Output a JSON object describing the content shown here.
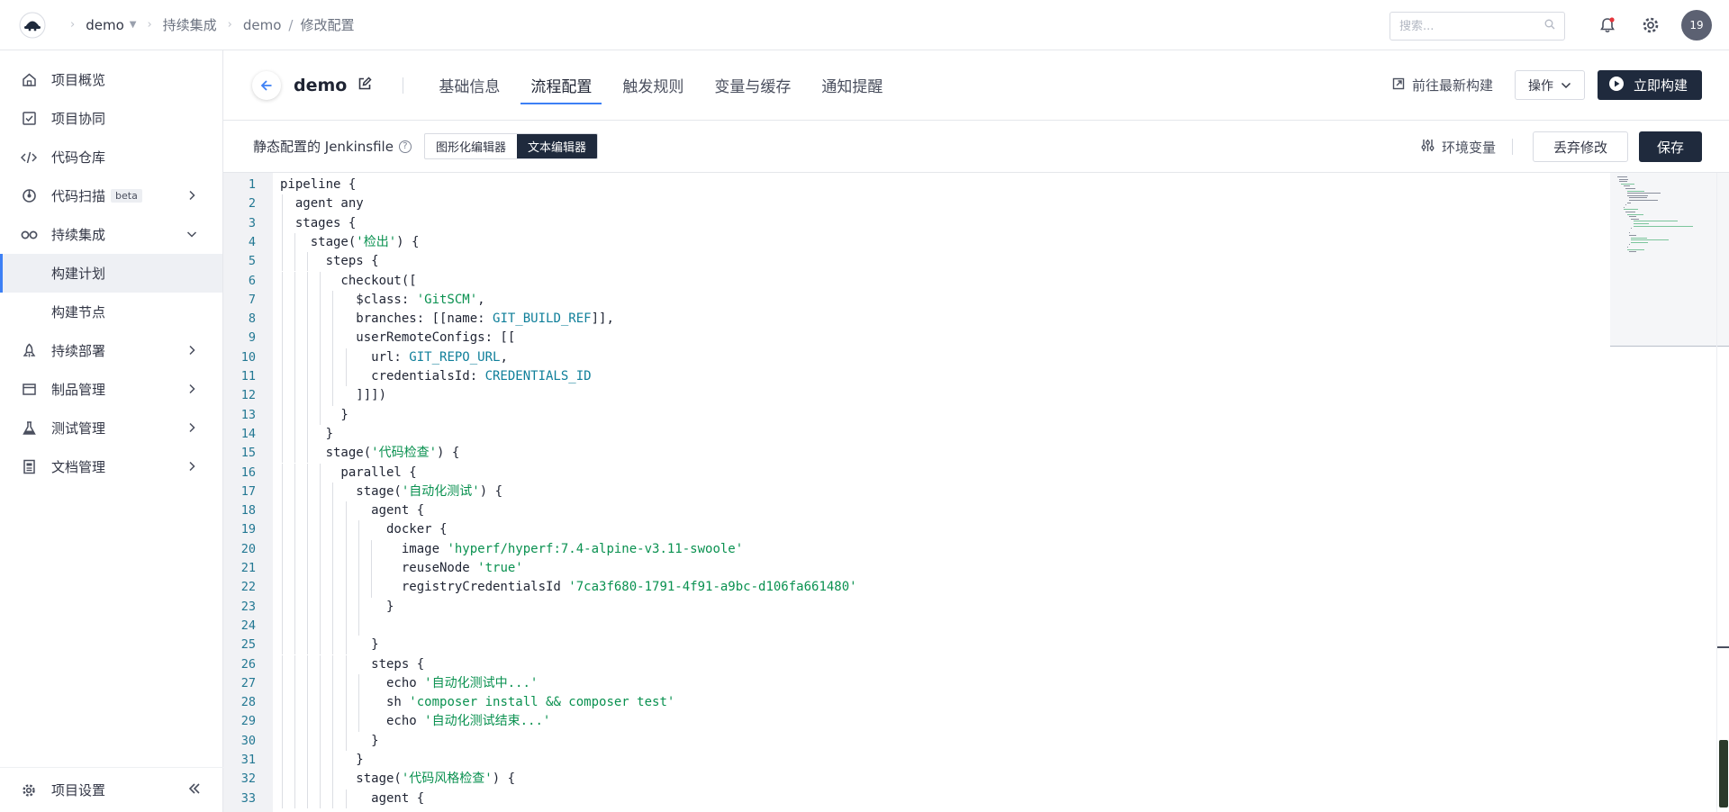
{
  "topbar": {
    "project": "demo",
    "breadcrumb": [
      "持续集成",
      "demo",
      "修改配置"
    ],
    "search_placeholder": "搜索...",
    "avatar": "19"
  },
  "sidebar": {
    "items": [
      {
        "label": "项目概览",
        "icon": "home-icon"
      },
      {
        "label": "项目协同",
        "icon": "checkbox-icon"
      },
      {
        "label": "代码仓库",
        "icon": "code-icon"
      },
      {
        "label": "代码扫描",
        "icon": "scan-icon",
        "badge": "beta"
      },
      {
        "label": "持续集成",
        "icon": "infinity-icon"
      },
      {
        "label": "构建计划",
        "icon": ""
      },
      {
        "label": "构建节点",
        "icon": ""
      },
      {
        "label": "持续部署",
        "icon": "rocket-icon"
      },
      {
        "label": "制品管理",
        "icon": "box-icon"
      },
      {
        "label": "测试管理",
        "icon": "flask-icon"
      },
      {
        "label": "文档管理",
        "icon": "doc-icon"
      }
    ],
    "settings": "项目设置"
  },
  "header": {
    "title": "demo",
    "tabs": [
      "基础信息",
      "流程配置",
      "触发规则",
      "变量与缓存",
      "通知提醒"
    ],
    "active_tab": "流程配置",
    "latest_build": "前往最新构建",
    "ops": "操作",
    "build_now": "立即构建"
  },
  "toolbar": {
    "label": "静态配置的 Jenkinsfile",
    "help": "?",
    "mode_graphic": "图形化编辑器",
    "mode_text": "文本编辑器",
    "env": "环境变量",
    "discard": "丢弃修改",
    "save": "保存"
  },
  "colors": {
    "accent": "#3d80f5",
    "dark_button": "#1f2a3d",
    "string": "#0a9150",
    "variable": "#0f7f9a",
    "line_number": "#237893"
  },
  "editor": {
    "lines": [
      "pipeline {",
      "  agent any",
      "  stages {",
      "    stage('检出') {",
      "      steps {",
      "        checkout([",
      "          $class: 'GitSCM',",
      "          branches: [[name: GIT_BUILD_REF]],",
      "          userRemoteConfigs: [[",
      "            url: GIT_REPO_URL,",
      "            credentialsId: CREDENTIALS_ID",
      "          ]]])",
      "        }",
      "      }",
      "      stage('代码检查') {",
      "        parallel {",
      "          stage('自动化测试') {",
      "            agent {",
      "              docker {",
      "                image 'hyperf/hyperf:7.4-alpine-v3.11-swoole'",
      "                reuseNode 'true'",
      "                registryCredentialsId '7ca3f680-1791-4f91-a9bc-d106fa661480'",
      "              }",
      "",
      "            }",
      "            steps {",
      "              echo '自动化测试中...'",
      "              sh 'composer install && composer test'",
      "              echo '自动化测试结束...'",
      "            }",
      "          }",
      "          stage('代码风格检查') {",
      "            agent {"
    ]
  }
}
